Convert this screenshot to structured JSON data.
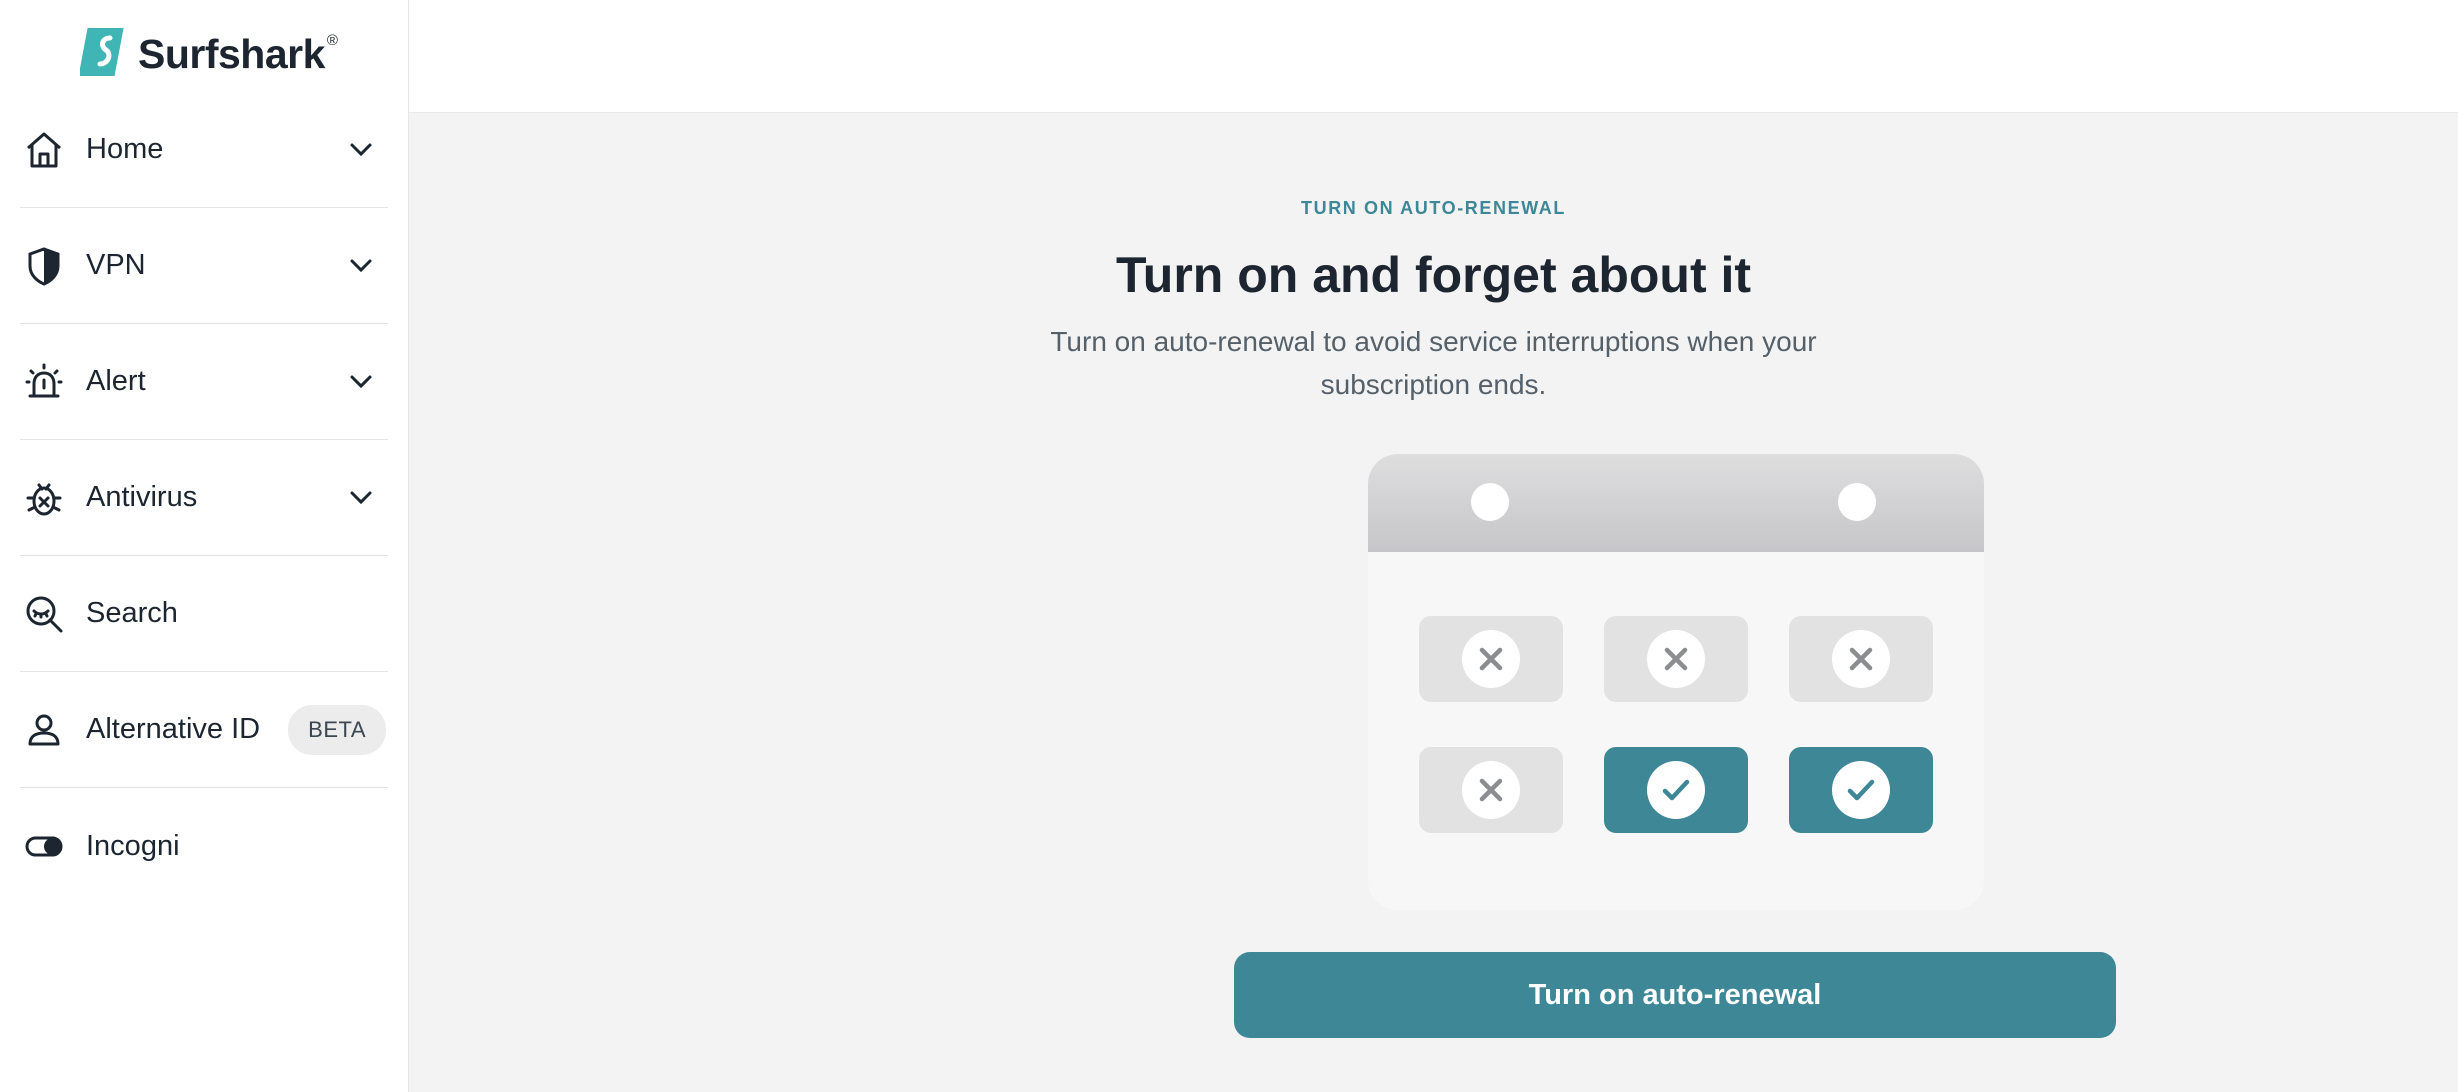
{
  "brand": {
    "name": "Surfshark",
    "registered": "®",
    "color": "#3fb5b6"
  },
  "sidebar": {
    "items": [
      {
        "label": "Home",
        "icon": "home-icon",
        "expandable": true
      },
      {
        "label": "VPN",
        "icon": "shield-icon",
        "expandable": true
      },
      {
        "label": "Alert",
        "icon": "alarm-icon",
        "expandable": true
      },
      {
        "label": "Antivirus",
        "icon": "bug-icon",
        "expandable": true
      },
      {
        "label": "Search",
        "icon": "search-eye-icon",
        "expandable": false
      },
      {
        "label": "Alternative ID",
        "icon": "user-icon",
        "badge": "BETA"
      },
      {
        "label": "Incogni",
        "icon": "toggle-icon"
      }
    ]
  },
  "main": {
    "eyebrow": "TURN ON AUTO-RENEWAL",
    "headline": "Turn on and forget about it",
    "description": "Turn on auto-renewal to avoid service interruptions when your subscription ends.",
    "illustration": {
      "cells": [
        "off",
        "off",
        "off",
        "off",
        "on",
        "on"
      ],
      "accent": "#3e8796"
    },
    "cta_label": "Turn on auto-renewal"
  }
}
